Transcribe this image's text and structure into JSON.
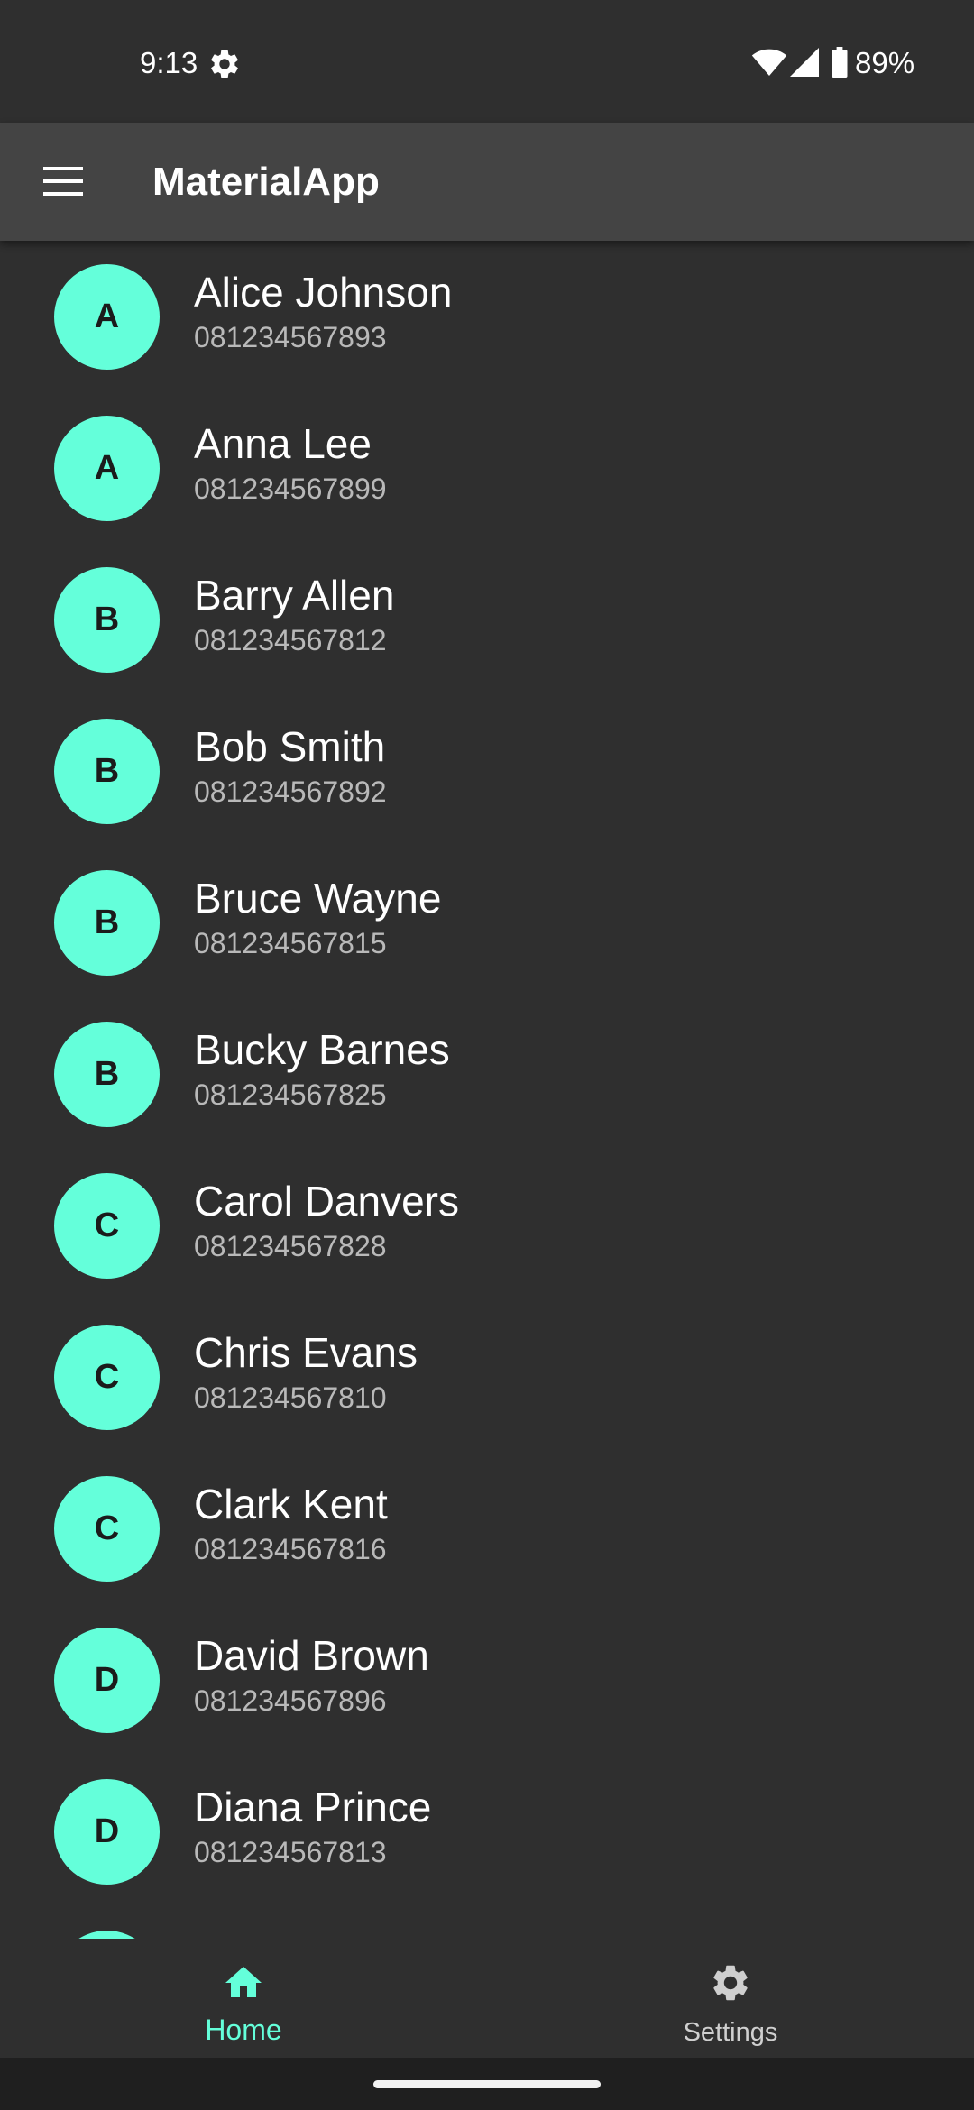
{
  "status_bar": {
    "time": "9:13",
    "battery_percent": "89%",
    "icons": [
      "gear-icon",
      "wifi-icon",
      "signal-icon",
      "battery-icon"
    ]
  },
  "app_bar": {
    "title": "MaterialApp",
    "menu_icon": "menu-icon"
  },
  "colors": {
    "accent": "#64ffda",
    "background": "#2f2f2f",
    "app_bar": "#444444",
    "secondary_text": "#b9b9b9"
  },
  "contacts": [
    {
      "initial": "A",
      "name": "Alice Johnson",
      "phone": "081234567893"
    },
    {
      "initial": "A",
      "name": "Anna Lee",
      "phone": "081234567899"
    },
    {
      "initial": "B",
      "name": "Barry Allen",
      "phone": "081234567812"
    },
    {
      "initial": "B",
      "name": "Bob Smith",
      "phone": "081234567892"
    },
    {
      "initial": "B",
      "name": "Bruce Wayne",
      "phone": "081234567815"
    },
    {
      "initial": "B",
      "name": "Bucky Barnes",
      "phone": "081234567825"
    },
    {
      "initial": "C",
      "name": "Carol Danvers",
      "phone": "081234567828"
    },
    {
      "initial": "C",
      "name": "Chris Evans",
      "phone": "081234567810"
    },
    {
      "initial": "C",
      "name": "Clark Kent",
      "phone": "081234567816"
    },
    {
      "initial": "D",
      "name": "David Brown",
      "phone": "081234567896"
    },
    {
      "initial": "D",
      "name": "Diana Prince",
      "phone": "081234567813"
    }
  ],
  "bottom_nav": {
    "items": [
      {
        "label": "Home",
        "icon": "home-icon",
        "selected": true
      },
      {
        "label": "Settings",
        "icon": "settings-icon",
        "selected": false
      }
    ]
  }
}
